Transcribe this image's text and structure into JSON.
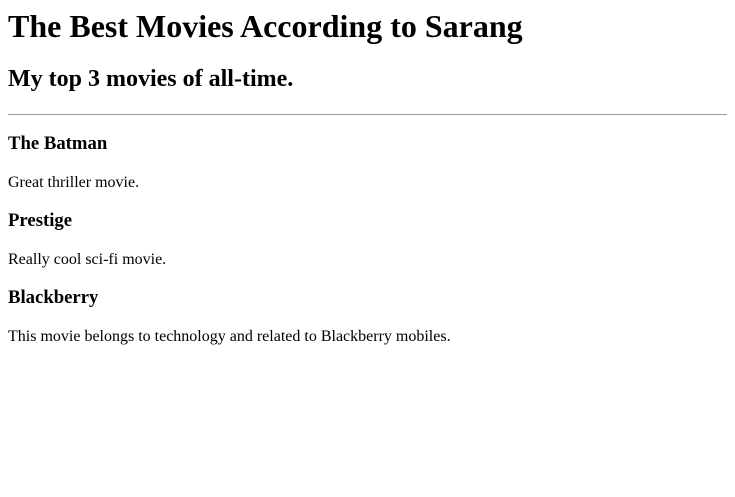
{
  "title": "The Best Movies According to Sarang",
  "subtitle": "My top 3 movies of all-time.",
  "movies": [
    {
      "name": "The Batman",
      "desc": "Great thriller movie."
    },
    {
      "name": "Prestige",
      "desc": "Really cool sci-fi movie."
    },
    {
      "name": "Blackberry",
      "desc": "This movie belongs to technology and related to Blackberry mobiles."
    }
  ]
}
